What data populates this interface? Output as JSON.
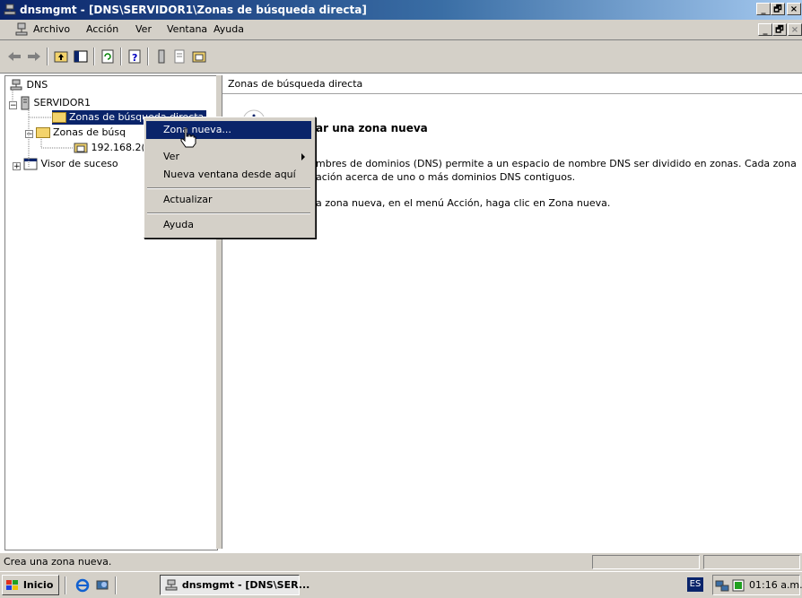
{
  "window": {
    "title": "dnsmgmt - [DNS\\SERVIDOR1\\Zonas de búsqueda directa]",
    "caption_min": "_",
    "caption_max": "🗗",
    "caption_close": "×"
  },
  "menubar": {
    "items": [
      {
        "label": "Archivo"
      },
      {
        "label": "Acción"
      },
      {
        "label": "Ver"
      },
      {
        "label": "Ventana"
      },
      {
        "label": "Ayuda"
      }
    ]
  },
  "toolbar": {
    "icons": [
      "back-arrow-icon",
      "forward-arrow-icon",
      "up-folder-icon",
      "show-hide-tree-icon",
      "refresh-icon",
      "properties-icon",
      "help-icon",
      "server-list-icon",
      "zone-list-icon",
      "new-zone-icon"
    ]
  },
  "tree": {
    "root": "DNS",
    "server": "SERVIDOR1",
    "forward_zones": "Zonas de búsqueda directa",
    "reverse_zones": "Zonas de búsq",
    "reverse_zone_child": "192.168.2(",
    "event_viewer": "Visor de suceso"
  },
  "right_pane": {
    "header": "Zonas de búsqueda directa",
    "heading": "ar una zona nueva",
    "paragraph1_line1": "mbres de dominios (DNS) permite a un espacio de nombre DNS ser dividido en zonas. Cada zona",
    "paragraph1_line2": "ación acerca de uno o más dominios DNS contiguos.",
    "paragraph2": "a zona nueva, en el menú Acción, haga clic en Zona nueva."
  },
  "context_menu": {
    "items": [
      {
        "label": "Zona nueva...",
        "highlighted": true
      },
      {
        "label": "Ver",
        "submenu": true
      },
      {
        "label": "Nueva ventana desde aquí"
      },
      {
        "label": "Actualizar"
      },
      {
        "label": "Ayuda"
      }
    ]
  },
  "statusbar": {
    "text": "Crea una zona nueva."
  },
  "taskbar": {
    "start_label": "Inicio",
    "task_label": "dnsmgmt - [DNS\\SER...",
    "language": "ES",
    "clock": "01:16 a.m."
  },
  "colors": {
    "titlebar_start": "#0a246a",
    "highlight": "#0a246a",
    "face": "#d4d0c8"
  }
}
